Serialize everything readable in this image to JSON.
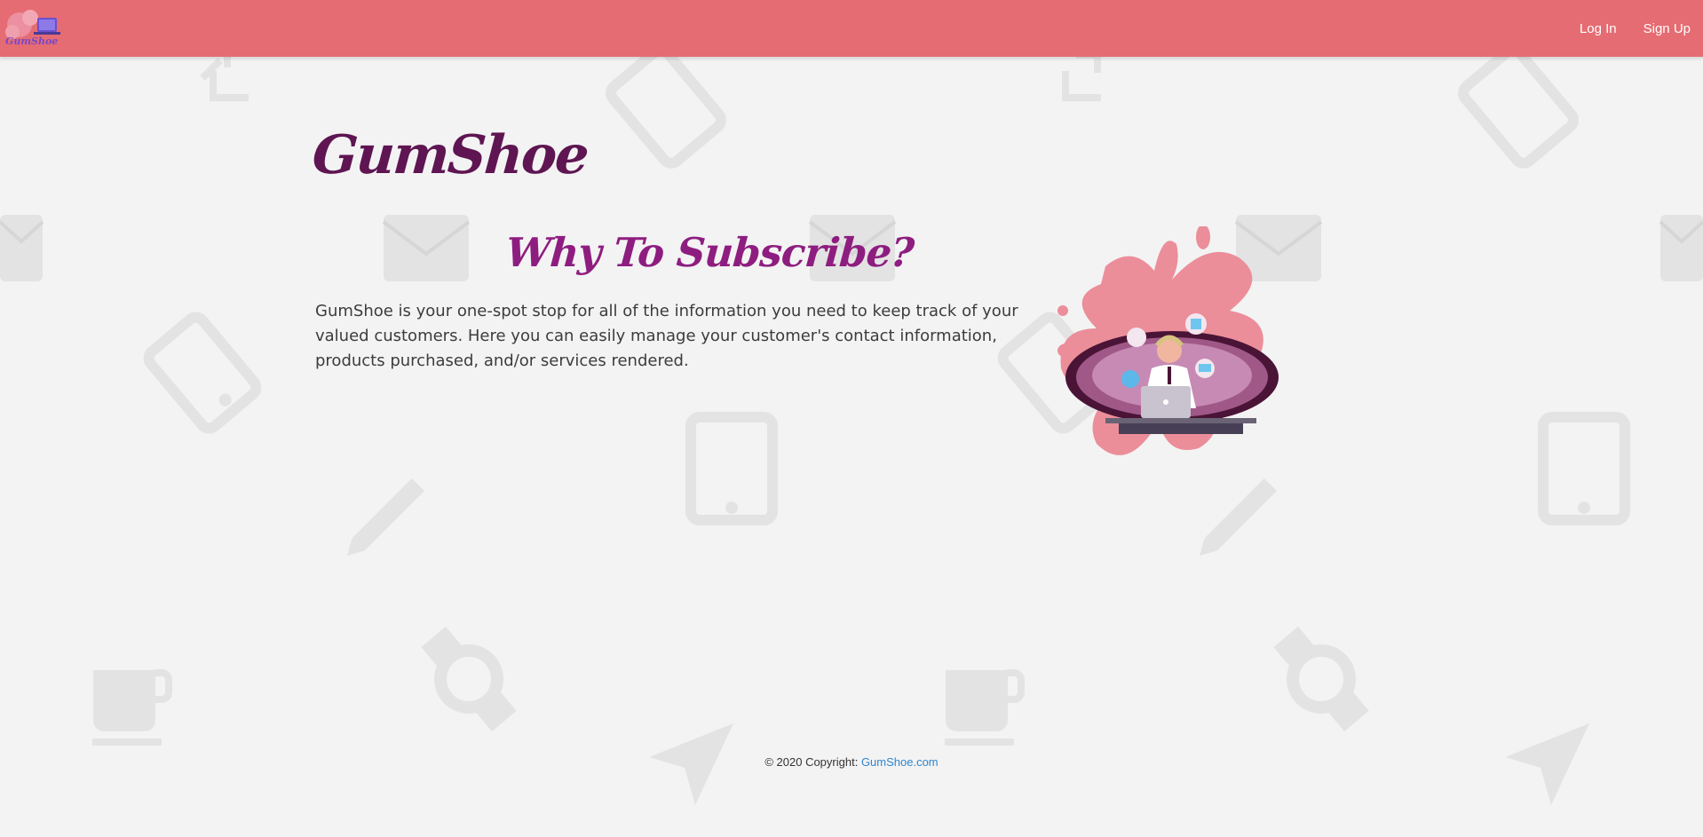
{
  "navbar": {
    "logo_text": "GumShoe",
    "login_label": "Log In",
    "signup_label": "Sign Up",
    "background_color": "#e56c72"
  },
  "main": {
    "brand_title": "GumShoe",
    "subtitle": "Why To Subscribe?",
    "description": "GumShoe is your one-spot stop for all of the information you need to keep track of your valued customers. Here you can easily manage your customer's contact information, products purchased, and/or services rendered."
  },
  "footer": {
    "copyright_text": "© 2020 Copyright: ",
    "site_link": "GumShoe.com"
  },
  "colors": {
    "brand_title": "#5e1552",
    "subtitle": "#8e1d80",
    "link": "#2f86cf",
    "pattern_icon": "#e3e3e3"
  },
  "icons": [
    "resize-icon",
    "phone-icon",
    "mail-icon",
    "tablet-icon",
    "pencil-icon",
    "mug-icon",
    "watch-icon",
    "send-icon"
  ]
}
